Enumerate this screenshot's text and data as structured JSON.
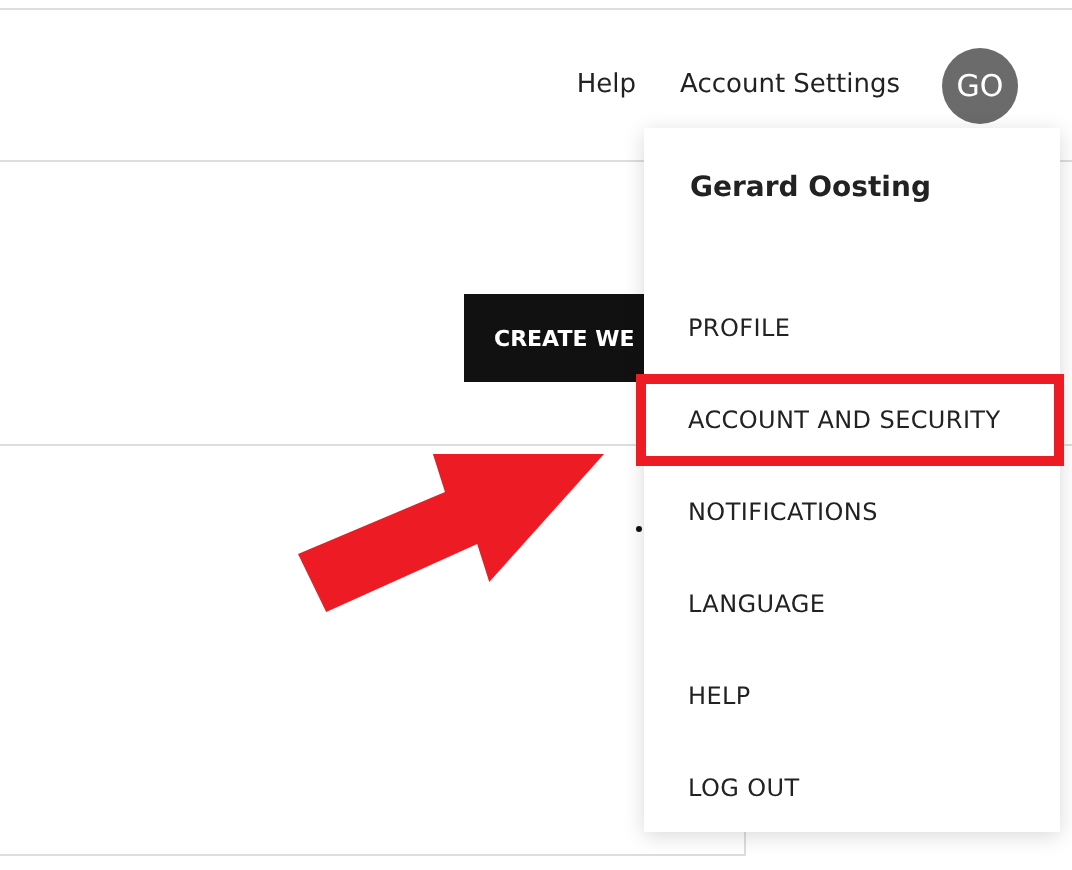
{
  "header": {
    "links": [
      "Help",
      "Account Settings"
    ],
    "avatar": "GO"
  },
  "content": {
    "button": "CREATE WE"
  },
  "menu": {
    "user_name": "Gerard Oosting",
    "items": [
      {
        "label": "PROFILE",
        "highlighted": false
      },
      {
        "label": "ACCOUNT AND SECURITY",
        "highlighted": true
      },
      {
        "label": "NOTIFICATIONS",
        "highlighted": false
      },
      {
        "label": "LANGUAGE",
        "highlighted": false
      },
      {
        "label": "HELP",
        "highlighted": false
      },
      {
        "label": "LOG OUT",
        "highlighted": false
      }
    ]
  }
}
